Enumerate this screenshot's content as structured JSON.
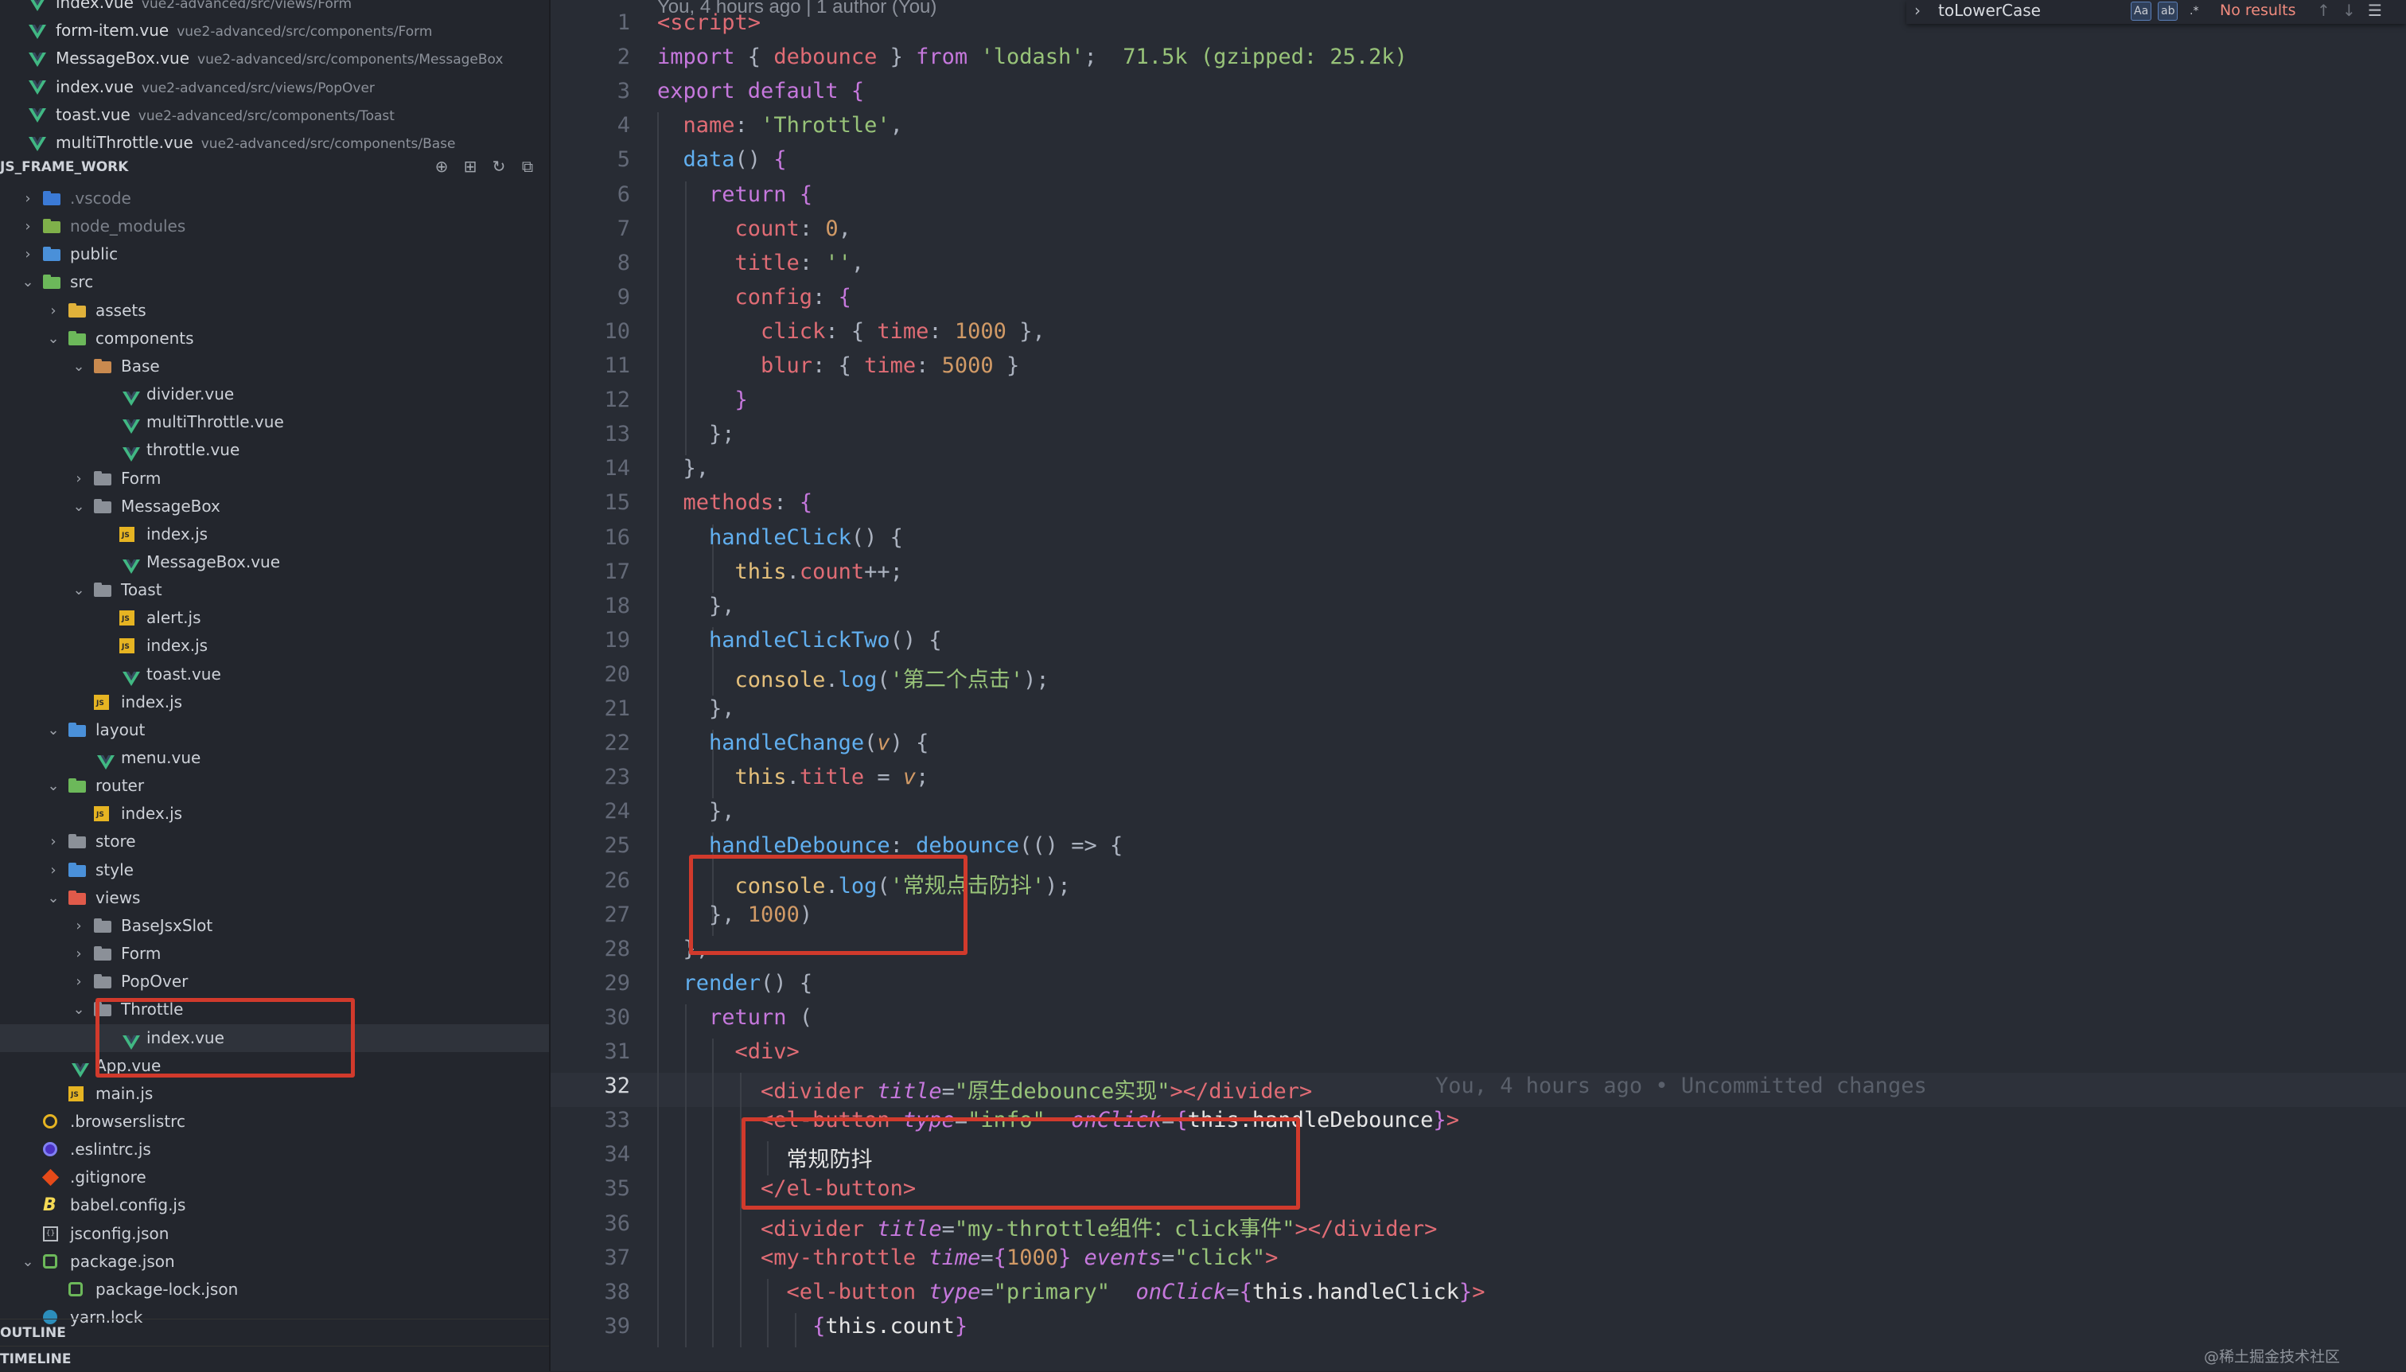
{
  "open_editors": [
    {
      "name": "index.vue",
      "path": "vue2-advanced/src/views/Form"
    },
    {
      "name": "form-item.vue",
      "path": "vue2-advanced/src/components/Form"
    },
    {
      "name": "MessageBox.vue",
      "path": "vue2-advanced/src/components/MessageBox"
    },
    {
      "name": "index.vue",
      "path": "vue2-advanced/src/views/PopOver"
    },
    {
      "name": "toast.vue",
      "path": "vue2-advanced/src/components/Toast"
    },
    {
      "name": "multiThrottle.vue",
      "path": "vue2-advanced/src/components/Base"
    }
  ],
  "explorer": {
    "title": "JS_FRAME_WORK",
    "tree": [
      {
        "label": ".vscode",
        "kind": "folder-vscode",
        "depth": 0,
        "chevron": "right",
        "dim": true
      },
      {
        "label": "node_modules",
        "kind": "folder-node",
        "depth": 0,
        "chevron": "right",
        "dim": true
      },
      {
        "label": "public",
        "kind": "folder-blue",
        "depth": 0,
        "chevron": "right"
      },
      {
        "label": "src",
        "kind": "folder-green",
        "depth": 0,
        "chevron": "down"
      },
      {
        "label": "assets",
        "kind": "folder-yellow",
        "depth": 1,
        "chevron": "right"
      },
      {
        "label": "components",
        "kind": "folder-green",
        "depth": 1,
        "chevron": "down"
      },
      {
        "label": "Base",
        "kind": "folder-orange",
        "depth": 2,
        "chevron": "down"
      },
      {
        "label": "divider.vue",
        "kind": "vue",
        "depth": 3
      },
      {
        "label": "multiThrottle.vue",
        "kind": "vue",
        "depth": 3
      },
      {
        "label": "throttle.vue",
        "kind": "vue",
        "depth": 3
      },
      {
        "label": "Form",
        "kind": "folder-gray",
        "depth": 2,
        "chevron": "right"
      },
      {
        "label": "MessageBox",
        "kind": "folder-gray",
        "depth": 2,
        "chevron": "down"
      },
      {
        "label": "index.js",
        "kind": "js",
        "depth": 3
      },
      {
        "label": "MessageBox.vue",
        "kind": "vue",
        "depth": 3
      },
      {
        "label": "Toast",
        "kind": "folder-gray",
        "depth": 2,
        "chevron": "down"
      },
      {
        "label": "alert.js",
        "kind": "js",
        "depth": 3
      },
      {
        "label": "index.js",
        "kind": "js",
        "depth": 3
      },
      {
        "label": "toast.vue",
        "kind": "vue",
        "depth": 3
      },
      {
        "label": "index.js",
        "kind": "js",
        "depth": 2
      },
      {
        "label": "layout",
        "kind": "folder-blue",
        "depth": 1,
        "chevron": "down"
      },
      {
        "label": "menu.vue",
        "kind": "vue",
        "depth": 2
      },
      {
        "label": "router",
        "kind": "folder-green",
        "depth": 1,
        "chevron": "down"
      },
      {
        "label": "index.js",
        "kind": "js",
        "depth": 2
      },
      {
        "label": "store",
        "kind": "folder-gray",
        "depth": 1,
        "chevron": "right"
      },
      {
        "label": "style",
        "kind": "folder-blue",
        "depth": 1,
        "chevron": "right"
      },
      {
        "label": "views",
        "kind": "folder-red",
        "depth": 1,
        "chevron": "down"
      },
      {
        "label": "BaseJsxSlot",
        "kind": "folder-gray",
        "depth": 2,
        "chevron": "right"
      },
      {
        "label": "Form",
        "kind": "folder-gray",
        "depth": 2,
        "chevron": "right"
      },
      {
        "label": "PopOver",
        "kind": "folder-gray",
        "depth": 2,
        "chevron": "right"
      },
      {
        "label": "Throttle",
        "kind": "folder-gray",
        "depth": 2,
        "chevron": "down"
      },
      {
        "label": "index.vue",
        "kind": "vue",
        "depth": 3,
        "selected": true
      },
      {
        "label": "App.vue",
        "kind": "vue",
        "depth": 1
      },
      {
        "label": "main.js",
        "kind": "js",
        "depth": 1
      },
      {
        "label": ".browserslistrc",
        "kind": "circle-yellow",
        "depth": 0
      },
      {
        "label": ".eslintrc.js",
        "kind": "circle-purple",
        "depth": 0
      },
      {
        "label": ".gitignore",
        "kind": "git",
        "depth": 0
      },
      {
        "label": "babel.config.js",
        "kind": "babel",
        "depth": 0
      },
      {
        "label": "jsconfig.json",
        "kind": "json",
        "depth": 0
      },
      {
        "label": "package.json",
        "kind": "node-green",
        "depth": 0,
        "chevron": "down"
      },
      {
        "label": "package-lock.json",
        "kind": "node-green",
        "depth": 1
      },
      {
        "label": "yarn.lock",
        "kind": "yarn",
        "depth": 0
      }
    ]
  },
  "outline_label": "OUTLINE",
  "timeline_label": "TIMELINE",
  "editor": {
    "blame_header": "You, 4 hours ago | 1 author (You)",
    "current_line": 32,
    "inline_blame": "You, 4 hours ago • Uncommitted changes",
    "lines": [
      [
        [
          "tag",
          "<script>"
        ]
      ],
      [
        [
          "kw",
          "import"
        ],
        [
          "plain",
          " { "
        ],
        [
          "prop",
          "debounce"
        ],
        [
          "plain",
          " } "
        ],
        [
          "kw",
          "from"
        ],
        [
          "plain",
          " "
        ],
        [
          "str",
          "'lodash'"
        ],
        [
          "plain",
          ";  "
        ],
        [
          "size",
          "71.5k (gzipped: 25.2k)"
        ]
      ],
      [
        [
          "kw",
          "export default"
        ],
        [
          "plain",
          " "
        ],
        [
          "brace",
          "{"
        ]
      ],
      [
        [
          "prop",
          "  name"
        ],
        [
          "plain",
          ": "
        ],
        [
          "str",
          "'Throttle'"
        ],
        [
          "plain",
          ","
        ]
      ],
      [
        [
          "fn",
          "  data"
        ],
        [
          "plain",
          "() "
        ],
        [
          "brace",
          "{"
        ]
      ],
      [
        [
          "kw",
          "    return"
        ],
        [
          "plain",
          " "
        ],
        [
          "brace",
          "{"
        ]
      ],
      [
        [
          "prop",
          "      count"
        ],
        [
          "plain",
          ": "
        ],
        [
          "num",
          "0"
        ],
        [
          "plain",
          ","
        ]
      ],
      [
        [
          "prop",
          "      title"
        ],
        [
          "plain",
          ": "
        ],
        [
          "str",
          "''"
        ],
        [
          "plain",
          ","
        ]
      ],
      [
        [
          "prop",
          "      config"
        ],
        [
          "plain",
          ": "
        ],
        [
          "brace",
          "{"
        ]
      ],
      [
        [
          "prop",
          "        click"
        ],
        [
          "plain",
          ": { "
        ],
        [
          "prop",
          "time"
        ],
        [
          "plain",
          ": "
        ],
        [
          "num",
          "1000"
        ],
        [
          "plain",
          " },"
        ]
      ],
      [
        [
          "prop",
          "        blur"
        ],
        [
          "plain",
          ": { "
        ],
        [
          "prop",
          "time"
        ],
        [
          "plain",
          ": "
        ],
        [
          "num",
          "5000"
        ],
        [
          "plain",
          " }"
        ]
      ],
      [
        [
          "brace",
          "      }"
        ]
      ],
      [
        [
          "plain",
          "    };"
        ]
      ],
      [
        [
          "plain",
          "  },"
        ]
      ],
      [
        [
          "prop",
          "  methods"
        ],
        [
          "plain",
          ": "
        ],
        [
          "brace",
          "{"
        ]
      ],
      [
        [
          "fn",
          "    handleClick"
        ],
        [
          "plain",
          "() {"
        ]
      ],
      [
        [
          "this",
          "      this"
        ],
        [
          "plain",
          "."
        ],
        [
          "prop",
          "count"
        ],
        [
          "plain",
          "++;"
        ]
      ],
      [
        [
          "plain",
          "    },"
        ]
      ],
      [
        [
          "fn",
          "    handleClickTwo"
        ],
        [
          "plain",
          "() {"
        ]
      ],
      [
        [
          "this",
          "      console"
        ],
        [
          "plain",
          "."
        ],
        [
          "fn",
          "log"
        ],
        [
          "plain",
          "("
        ],
        [
          "str",
          "'第二个点击'"
        ],
        [
          "plain",
          ");"
        ]
      ],
      [
        [
          "plain",
          "    },"
        ]
      ],
      [
        [
          "fn",
          "    handleChange"
        ],
        [
          "plain",
          "("
        ],
        [
          "var",
          "v"
        ],
        [
          "plain",
          ") {"
        ]
      ],
      [
        [
          "this",
          "      this"
        ],
        [
          "plain",
          "."
        ],
        [
          "prop",
          "title"
        ],
        [
          "plain",
          " = "
        ],
        [
          "var",
          "v"
        ],
        [
          "plain",
          ";"
        ]
      ],
      [
        [
          "plain",
          "    },"
        ]
      ],
      [
        [
          "fn",
          "    handleDebounce"
        ],
        [
          "plain",
          ": "
        ],
        [
          "fn",
          "debounce"
        ],
        [
          "plain",
          "(() => {"
        ]
      ],
      [
        [
          "this",
          "      console"
        ],
        [
          "plain",
          "."
        ],
        [
          "fn",
          "log"
        ],
        [
          "plain",
          "("
        ],
        [
          "str",
          "'常规点击防抖'"
        ],
        [
          "plain",
          ");"
        ]
      ],
      [
        [
          "plain",
          "    }, "
        ],
        [
          "num",
          "1000"
        ],
        [
          "plain",
          ")"
        ]
      ],
      [
        [
          "plain",
          "  },"
        ]
      ],
      [
        [
          "fn",
          "  render"
        ],
        [
          "plain",
          "() {"
        ]
      ],
      [
        [
          "kw",
          "    return"
        ],
        [
          "plain",
          " ("
        ]
      ],
      [
        [
          "tag",
          "      <div>"
        ]
      ],
      [
        [
          "tag",
          "        <divider"
        ],
        [
          "plain",
          " "
        ],
        [
          "attr",
          "title"
        ],
        [
          "plain",
          "="
        ],
        [
          "str",
          "\"原生debounce实现\""
        ],
        [
          "tag",
          "></divider>"
        ]
      ],
      [
        [
          "tag",
          "        <el-button"
        ],
        [
          "plain",
          " "
        ],
        [
          "attr",
          "type"
        ],
        [
          "plain",
          "="
        ],
        [
          "str",
          "\"info\""
        ],
        [
          "plain",
          "  "
        ],
        [
          "attr",
          "onClick"
        ],
        [
          "plain",
          "="
        ],
        [
          "brace",
          "{"
        ],
        [
          "text",
          "this.handleDebounce"
        ],
        [
          "brace",
          "}"
        ],
        [
          "tag",
          ">"
        ]
      ],
      [
        [
          "text",
          "          常规防抖"
        ]
      ],
      [
        [
          "tag",
          "        </el-button>"
        ]
      ],
      [
        [
          "tag",
          "        <divider"
        ],
        [
          "plain",
          " "
        ],
        [
          "attr",
          "title"
        ],
        [
          "plain",
          "="
        ],
        [
          "str",
          "\"my-throttle组件：click事件\""
        ],
        [
          "tag",
          "></divider>"
        ]
      ],
      [
        [
          "tag",
          "        <my-throttle"
        ],
        [
          "plain",
          " "
        ],
        [
          "attr",
          "time"
        ],
        [
          "plain",
          "="
        ],
        [
          "brace",
          "{"
        ],
        [
          "num",
          "1000"
        ],
        [
          "brace",
          "}"
        ],
        [
          "plain",
          " "
        ],
        [
          "attr",
          "events"
        ],
        [
          "plain",
          "="
        ],
        [
          "str",
          "\"click\""
        ],
        [
          "tag",
          ">"
        ]
      ],
      [
        [
          "tag",
          "          <el-button"
        ],
        [
          "plain",
          " "
        ],
        [
          "attr",
          "type"
        ],
        [
          "plain",
          "="
        ],
        [
          "str",
          "\"primary\""
        ],
        [
          "plain",
          "  "
        ],
        [
          "attr",
          "onClick"
        ],
        [
          "plain",
          "="
        ],
        [
          "brace",
          "{"
        ],
        [
          "text",
          "this.handleClick"
        ],
        [
          "brace",
          "}"
        ],
        [
          "tag",
          ">"
        ]
      ],
      [
        [
          "plain",
          "            "
        ],
        [
          "brace",
          "{"
        ],
        [
          "text",
          "this.count"
        ],
        [
          "brace",
          "}"
        ]
      ]
    ]
  },
  "find_widget": {
    "query": "toLowerCase",
    "opt_case": "Aa",
    "opt_word": "ab",
    "opt_regex": ".*",
    "result": "No results"
  },
  "watermark": "@稀土掘金技术社区"
}
